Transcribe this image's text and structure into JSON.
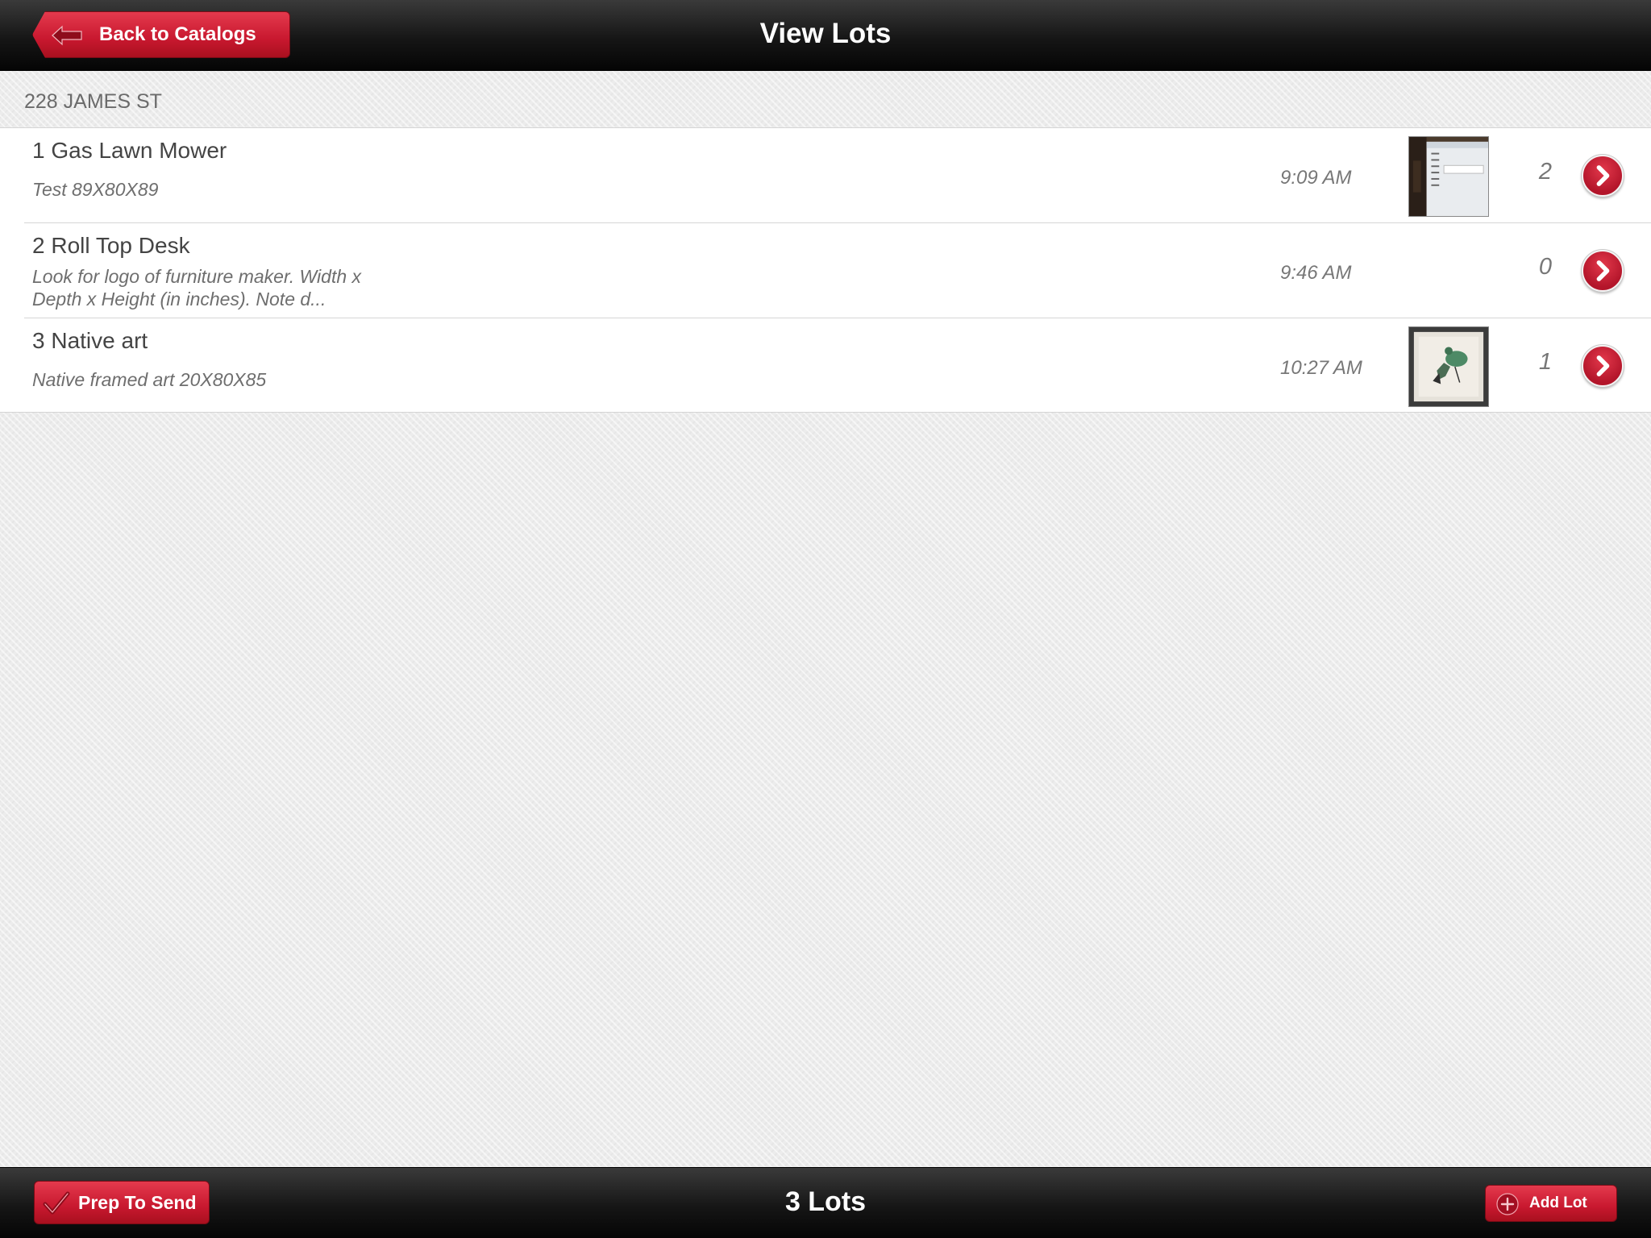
{
  "header": {
    "title": "View Lots",
    "back_label": "Back to Catalogs"
  },
  "section": {
    "title": "228 JAMES ST"
  },
  "lots": [
    {
      "title": "1 Gas Lawn Mower",
      "description": "Test 89X80X89",
      "time": "9:09 AM",
      "photo_count": "2",
      "has_thumbnail": true
    },
    {
      "title": "2 Roll Top Desk",
      "description": "Look for logo of furniture maker. Width x Depth x Height (in inches).  Note d...",
      "time": "9:46 AM",
      "photo_count": "0",
      "has_thumbnail": false
    },
    {
      "title": "3 Native art",
      "description": "Native framed art 20X80X85",
      "time": "10:27 AM",
      "photo_count": "1",
      "has_thumbnail": true
    }
  ],
  "footer": {
    "prep_label": "Prep To Send",
    "lot_count": "3 Lots",
    "add_label": "Add Lot"
  },
  "colors": {
    "accent": "#c8182f",
    "bar_dark": "#111111",
    "background": "#ececec"
  },
  "icons": {
    "back": "arrow-left-icon",
    "row_action": "chevron-right-icon",
    "prep": "checkmark-icon",
    "add": "plus-circle-icon"
  }
}
